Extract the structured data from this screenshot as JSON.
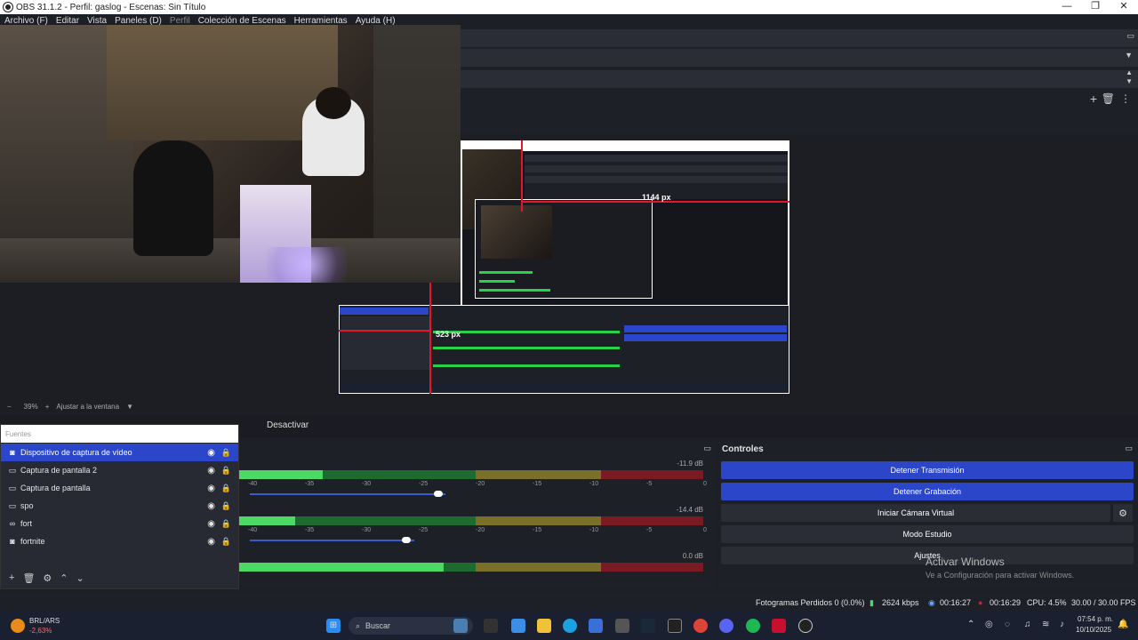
{
  "window": {
    "title": "OBS 31.1.2 - Perfil: gaslog - Escenas: Sin Título",
    "minimize": "—",
    "maximize": "❐",
    "close": "✕"
  },
  "menu": [
    "Archivo (F)",
    "Editar",
    "Vista",
    "Paneles (D)",
    "Perfil",
    "Colección de Escenas",
    "Herramientas",
    "Ayuda (H)"
  ],
  "preview": {
    "label_h": "1144 px",
    "label_v": "523 px"
  },
  "zoom": {
    "minus": "−",
    "percent": "39%",
    "plus": "+",
    "fit": "Ajustar a la ventana"
  },
  "scene_bar": {
    "deactivate": "Desactivar"
  },
  "sources": {
    "header": "Fuentes",
    "items": [
      {
        "icon": "camera-icon",
        "glyph": "◙",
        "label": "Dispositivo de captura de vídeo",
        "selected": true
      },
      {
        "icon": "monitor-icon",
        "glyph": "▭",
        "label": "Captura de pantalla 2",
        "selected": false
      },
      {
        "icon": "monitor-icon",
        "glyph": "▭",
        "label": "Captura de pantalla",
        "selected": false
      },
      {
        "icon": "monitor-icon",
        "glyph": "▭",
        "label": "spo",
        "selected": false
      },
      {
        "icon": "link-icon",
        "glyph": "∞",
        "label": "fort",
        "selected": false
      },
      {
        "icon": "camera-icon",
        "glyph": "◙",
        "label": "fortnite",
        "selected": false
      }
    ],
    "tools": [
      "+",
      "🗑",
      "⚙",
      "⌃",
      "⌄"
    ]
  },
  "mixer": {
    "channels": [
      {
        "db": "-11.9 dB",
        "level": 0.18
      },
      {
        "db": "-14.4 dB",
        "level": 0.12
      },
      {
        "db": "0.0 dB",
        "level": 0.44
      }
    ],
    "ticks": [
      "-40",
      "-35",
      "-30",
      "-25",
      "-20",
      "-15",
      "-10",
      "-5",
      "0"
    ]
  },
  "controls": {
    "title": "Controles",
    "stop_stream": "Detener Transmisión",
    "stop_record": "Detener Grabación",
    "virtual_cam": "Iniciar Cámara Virtual",
    "studio_mode": "Modo Estudio",
    "settings": "Ajustes",
    "watermark_title": "Activar Windows",
    "watermark_sub": "Ve a Configuración para activar Windows."
  },
  "status": {
    "dropped": "Fotogramas Perdidos 0 (0.0%)",
    "bitrate": "2624 kbps",
    "stream_time": "00:16:27",
    "rec_time": "00:16:29",
    "cpu": "CPU: 4.5%",
    "fps": "30.00 / 30.00 FPS"
  },
  "taskbar": {
    "stock_name": "BRL/ARS",
    "stock_change": "-2,63%",
    "search_placeholder": "Buscar",
    "time": "07:54 p. m.",
    "date": "10/10/2025"
  },
  "colors": {
    "accent": "#2c46c9",
    "record_red": "#e8132c",
    "meter_green": "#4cd964"
  }
}
